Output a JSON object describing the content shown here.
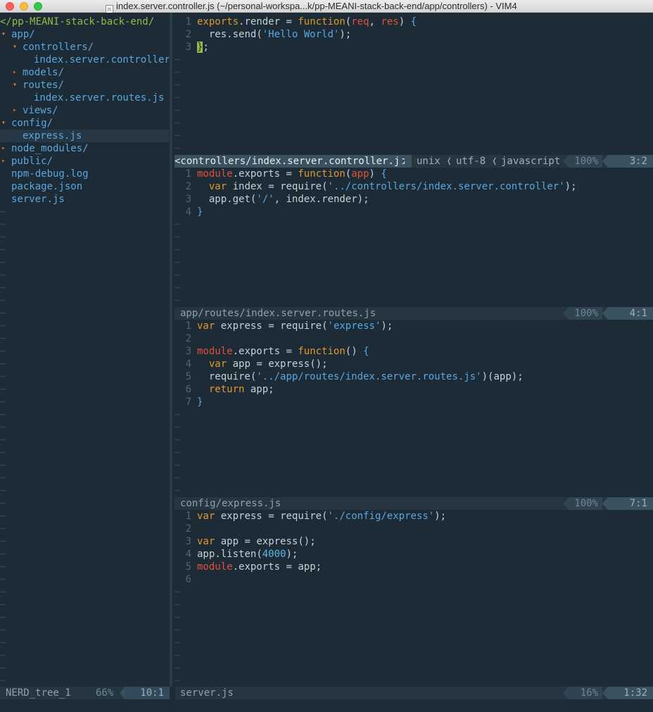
{
  "window": {
    "title": "index.server.controller.js (~/personal-workspa...k/pp-MEANI-stack-back-end/app/controllers) - VIM4",
    "file_icon": "js"
  },
  "nerdtree": {
    "root": "</pp-MEANI-stack-back-end/",
    "items": [
      {
        "arrow": "▾",
        "label": "app/",
        "type": "dir",
        "indent": 0
      },
      {
        "arrow": "▾",
        "label": "controllers/",
        "type": "dir",
        "indent": 1
      },
      {
        "arrow": "",
        "label": "index.server.controller.",
        "type": "file",
        "indent": 2
      },
      {
        "arrow": "▸",
        "label": "models/",
        "type": "dir",
        "indent": 1
      },
      {
        "arrow": "▾",
        "label": "routes/",
        "type": "dir",
        "indent": 1
      },
      {
        "arrow": "",
        "label": "index.server.routes.js",
        "type": "file",
        "indent": 2
      },
      {
        "arrow": "▸",
        "label": "views/",
        "type": "dir",
        "indent": 1
      },
      {
        "arrow": "▾",
        "label": "config/",
        "type": "dir",
        "indent": 0
      },
      {
        "arrow": "",
        "label": "express.js",
        "type": "file",
        "indent": 1
      },
      {
        "arrow": "▸",
        "label": "node_modules/",
        "type": "dir",
        "indent": 0
      },
      {
        "arrow": "▸",
        "label": "public/",
        "type": "dir",
        "indent": 0
      },
      {
        "arrow": "",
        "label": "npm-debug.log",
        "type": "file",
        "indent": 0
      },
      {
        "arrow": "",
        "label": "package.json",
        "type": "file",
        "indent": 0
      },
      {
        "arrow": "",
        "label": "server.js",
        "type": "file",
        "indent": 0
      }
    ],
    "status": {
      "name": "NERD_tree_1",
      "percent": "66%",
      "position": "10:1"
    }
  },
  "panes": [
    {
      "status": {
        "file": "<controllers/index.server.controller.js",
        "format": "unix",
        "encoding": "utf-8",
        "filetype": "javascript",
        "percent": "100%",
        "position": "3:2"
      },
      "lines": [
        {
          "n": "1",
          "code": "exports.render = function(req, res) {"
        },
        {
          "n": "2",
          "code": "  res.send('Hello World');"
        },
        {
          "n": "3",
          "code": "};"
        }
      ]
    },
    {
      "status": {
        "file": "app/routes/index.server.routes.js",
        "percent": "100%",
        "position": "4:1"
      },
      "lines": [
        {
          "n": "1",
          "code": "module.exports = function(app) {"
        },
        {
          "n": "2",
          "code": "  var index = require('../controllers/index.server.controller');"
        },
        {
          "n": "3",
          "code": "  app.get('/', index.render);"
        },
        {
          "n": "4",
          "code": "}"
        }
      ]
    },
    {
      "status": {
        "file": "config/express.js",
        "percent": "100%",
        "position": "7:1"
      },
      "lines": [
        {
          "n": "1",
          "code": "var express = require('express');"
        },
        {
          "n": "2",
          "code": ""
        },
        {
          "n": "3",
          "code": "module.exports = function() {"
        },
        {
          "n": "4",
          "code": "  var app = express();"
        },
        {
          "n": "5",
          "code": "  require('../app/routes/index.server.routes.js')(app);"
        },
        {
          "n": "6",
          "code": "  return app;"
        },
        {
          "n": "7",
          "code": "}"
        }
      ]
    },
    {
      "status": {
        "file": "server.js",
        "percent": "16%",
        "position": "1:32"
      },
      "lines": [
        {
          "n": "1",
          "code": "var express = require('./config/express');"
        },
        {
          "n": "2",
          "code": ""
        },
        {
          "n": "3",
          "code": "var app = express();"
        },
        {
          "n": "4",
          "code": "app.listen(4000);"
        },
        {
          "n": "5",
          "code": "module.exports = app;"
        },
        {
          "n": "6",
          "code": ""
        }
      ]
    }
  ],
  "tilde": "~"
}
